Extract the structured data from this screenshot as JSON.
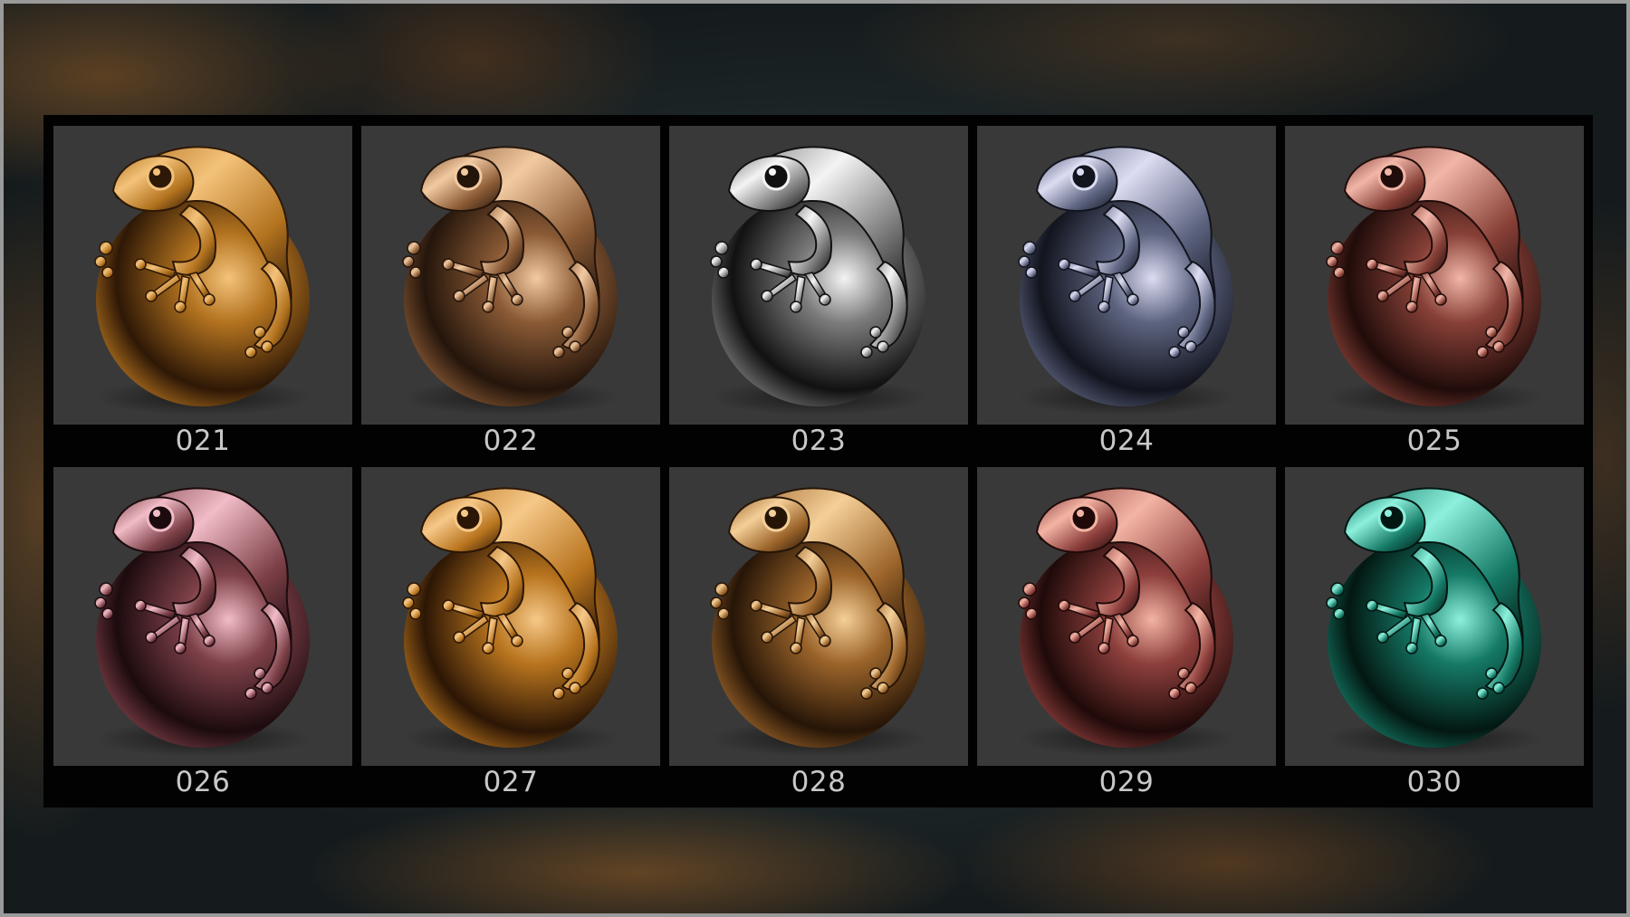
{
  "materials": [
    {
      "label": "021",
      "icon": "frog-sphere-icon",
      "light": "#f3c27a",
      "mid": "#b3731f",
      "dark": "#2e1806"
    },
    {
      "label": "022",
      "icon": "frog-sphere-icon",
      "light": "#f2caa2",
      "mid": "#8a5a35",
      "dark": "#24150b"
    },
    {
      "label": "023",
      "icon": "frog-sphere-icon",
      "light": "#f4f4f4",
      "mid": "#7c7c7c",
      "dark": "#111111"
    },
    {
      "label": "024",
      "icon": "frog-sphere-icon",
      "light": "#dcdcf2",
      "mid": "#5d6480",
      "dark": "#12141e"
    },
    {
      "label": "025",
      "icon": "frog-sphere-icon",
      "light": "#f1b6a8",
      "mid": "#874037",
      "dark": "#200c0a"
    },
    {
      "label": "026",
      "icon": "frog-sphere-icon",
      "light": "#f1bcc6",
      "mid": "#7d4048",
      "dark": "#1c0b0e"
    },
    {
      "label": "027",
      "icon": "frog-sphere-icon",
      "light": "#f6c888",
      "mid": "#b8741e",
      "dark": "#2c1605"
    },
    {
      "label": "028",
      "icon": "frog-sphere-icon",
      "light": "#f4cf98",
      "mid": "#9b642a",
      "dark": "#261507"
    },
    {
      "label": "029",
      "icon": "frog-sphere-icon",
      "light": "#f3b4a4",
      "mid": "#8d3f3c",
      "dark": "#1f0a09"
    },
    {
      "label": "030",
      "icon": "frog-sphere-icon",
      "light": "#8cf0dc",
      "mid": "#157a66",
      "dark": "#031712"
    }
  ]
}
